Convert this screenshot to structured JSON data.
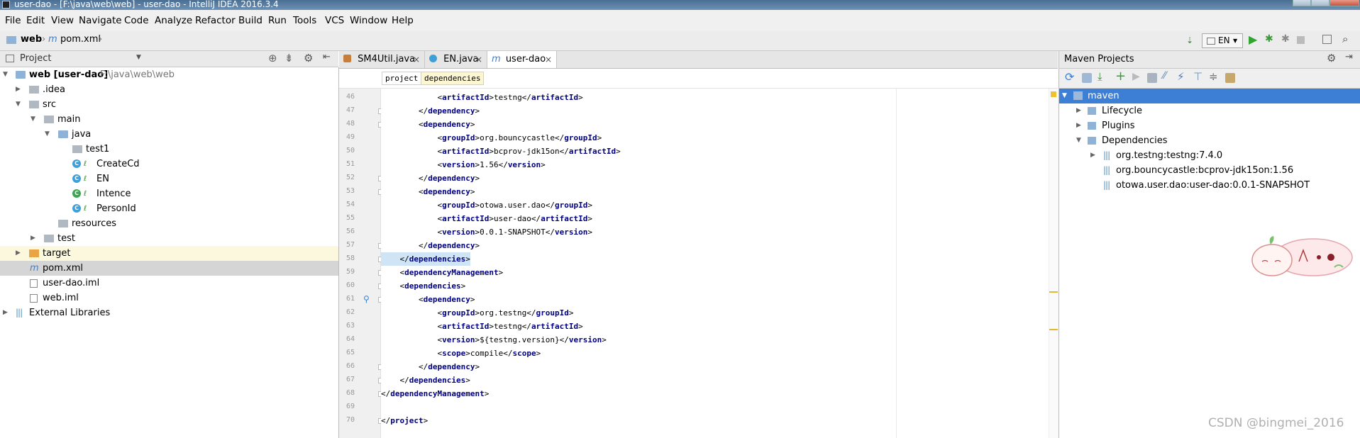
{
  "window": {
    "title": "user-dao - [F:\\java\\web\\web] - user-dao - IntelliJ IDEA 2016.3.4"
  },
  "menu": [
    "File",
    "Edit",
    "View",
    "Navigate",
    "Code",
    "Analyze",
    "Refactor",
    "Build",
    "Run",
    "Tools",
    "VCS",
    "Window",
    "Help"
  ],
  "navbar": {
    "crumb1": "web",
    "crumb2": "pom.xml",
    "run_config": "EN"
  },
  "project_panel": {
    "title": "Project",
    "tree": [
      {
        "label": "web [user-dao]",
        "sub": "F:\\java\\web\\web"
      },
      {
        "label": ".idea"
      },
      {
        "label": "src"
      },
      {
        "label": "main"
      },
      {
        "label": "java"
      },
      {
        "label": "test1"
      },
      {
        "label": "CreateCd"
      },
      {
        "label": "EN"
      },
      {
        "label": "Intence"
      },
      {
        "label": "PersonId"
      },
      {
        "label": "resources"
      },
      {
        "label": "test"
      },
      {
        "label": "target"
      },
      {
        "label": "pom.xml"
      },
      {
        "label": "user-dao.iml"
      },
      {
        "label": "web.iml"
      },
      {
        "label": "External Libraries"
      }
    ]
  },
  "editor": {
    "tabs": [
      "SM4Util.java",
      "EN.java",
      "user-dao"
    ],
    "crumbs": [
      "project",
      "dependencies"
    ],
    "lines": [
      {
        "n": "46",
        "t": "            <artifactId>testng</artifactId>"
      },
      {
        "n": "47",
        "t": "        </dependency>"
      },
      {
        "n": "48",
        "t": "        <dependency>"
      },
      {
        "n": "49",
        "t": "            <groupId>org.bouncycastle</groupId>"
      },
      {
        "n": "50",
        "t": "            <artifactId>bcprov-jdk15on</artifactId>"
      },
      {
        "n": "51",
        "t": "            <version>1.56</version>"
      },
      {
        "n": "52",
        "t": "        </dependency>"
      },
      {
        "n": "53",
        "t": "        <dependency>"
      },
      {
        "n": "54",
        "t": "            <groupId>otowa.user.dao</groupId>"
      },
      {
        "n": "55",
        "t": "            <artifactId>user-dao</artifactId>"
      },
      {
        "n": "56",
        "t": "            <version>0.0.1-SNAPSHOT</version>"
      },
      {
        "n": "57",
        "t": "        </dependency>"
      },
      {
        "n": "58",
        "t": "    </dependencies>"
      },
      {
        "n": "59",
        "t": "    <dependencyManagement>"
      },
      {
        "n": "60",
        "t": "    <dependencies>"
      },
      {
        "n": "61",
        "t": "        <dependency>"
      },
      {
        "n": "62",
        "t": "            <groupId>org.testng</groupId>"
      },
      {
        "n": "63",
        "t": "            <artifactId>testng</artifactId>"
      },
      {
        "n": "64",
        "t": "            <version>${testng.version}</version>"
      },
      {
        "n": "65",
        "t": "            <scope>compile</scope>"
      },
      {
        "n": "66",
        "t": "        </dependency>"
      },
      {
        "n": "67",
        "t": "    </dependencies>"
      },
      {
        "n": "68",
        "t": "</dependencyManagement>"
      },
      {
        "n": "69",
        "t": ""
      },
      {
        "n": "70",
        "t": "</project>"
      }
    ]
  },
  "maven_panel": {
    "title": "Maven Projects",
    "tree": [
      {
        "label": "maven"
      },
      {
        "label": "Lifecycle"
      },
      {
        "label": "Plugins"
      },
      {
        "label": "Dependencies"
      },
      {
        "label": "org.testng:testng:7.4.0"
      },
      {
        "label": "org.bouncycastle:bcprov-jdk15on:1.56"
      },
      {
        "label": "otowa.user.dao:user-dao:0.0.1-SNAPSHOT"
      }
    ]
  },
  "watermark": "CSDN @bingmei_2016",
  "colors": {
    "selection": "#3d7fd4",
    "tag": "#000080",
    "highlight": "#cfe5f5"
  }
}
